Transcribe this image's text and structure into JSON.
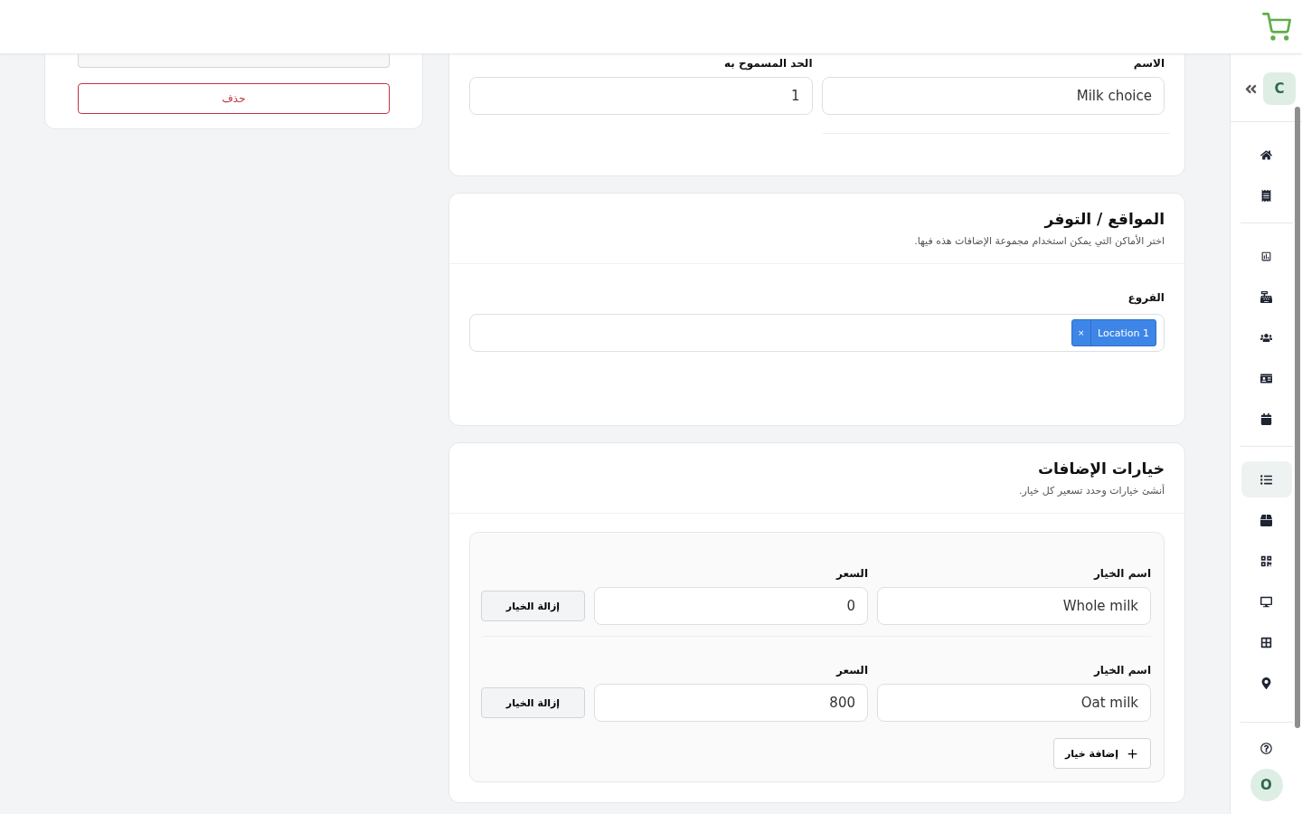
{
  "side_card": {
    "delete_button": "حذف"
  },
  "general": {
    "fields": [
      {
        "label": "الاسم",
        "value": "Milk choice"
      },
      {
        "label": "الحد المسموح به",
        "value": "1"
      }
    ]
  },
  "locations": {
    "title": "المواقع / التوفر",
    "subtitle": "اختر الأماكن التي يمكن استخدام مجموعة الإضافات هذه فيها.",
    "branches_label": "الفروع",
    "tags": [
      {
        "remove": "×",
        "label": "Location 1"
      }
    ]
  },
  "options": {
    "title": "خيارات الإضافات",
    "subtitle": "أنشئ خيارات وحدد تسعير كل خيار.",
    "rows": [
      {
        "name_label": "اسم الخيار",
        "name": "Whole milk",
        "price_label": "السعر",
        "price": "0",
        "remove_button": "إزالة الخيار"
      },
      {
        "name_label": "اسم الخيار",
        "name": "Oat milk",
        "price_label": "السعر",
        "price": "800",
        "remove_button": "إزالة الخيار"
      }
    ],
    "add_button": "إضافة خيار"
  },
  "sidebar": {
    "workspace_initial": "C",
    "groups": [
      {
        "items": [
          {
            "selected": false
          },
          {
            "selected": false
          }
        ]
      },
      {
        "items": [
          {
            "selected": false
          },
          {
            "selected": false
          },
          {
            "selected": false
          },
          {
            "selected": false
          },
          {
            "selected": false
          }
        ]
      },
      {
        "items": [
          {
            "selected": true
          },
          {
            "selected": false
          },
          {
            "selected": false
          },
          {
            "selected": false
          },
          {
            "selected": false
          },
          {
            "selected": false
          }
        ]
      }
    ],
    "user_initial": "O"
  }
}
